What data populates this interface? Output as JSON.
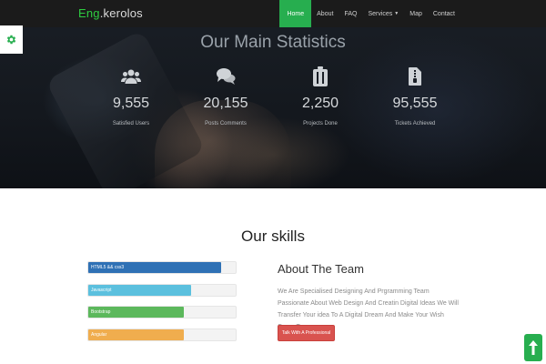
{
  "navbar": {
    "brand_prefix": "Eng",
    "brand_suffix": ".kerolos",
    "items": [
      {
        "label": "Home"
      },
      {
        "label": "About"
      },
      {
        "label": "FAQ"
      },
      {
        "label": "Services"
      },
      {
        "label": "Map"
      },
      {
        "label": "Contact"
      }
    ],
    "active_color": "#27ae4f"
  },
  "settings_icon": "gear-icon",
  "statistics": {
    "title": "Our Main Statistics",
    "items": [
      {
        "icon": "users-icon",
        "value": "9,555",
        "label": "Satisfied Users"
      },
      {
        "icon": "comments-icon",
        "value": "20,155",
        "label": "Posts Comments"
      },
      {
        "icon": "briefcase-icon",
        "value": "2,250",
        "label": "Projects Done"
      },
      {
        "icon": "file-icon",
        "value": "95,555",
        "label": "Tickets Achieved"
      }
    ]
  },
  "skills": {
    "title": "Our skills",
    "bars": [
      {
        "label": "HTML5 && css3",
        "percent": 90,
        "color": "#2f71b5"
      },
      {
        "label": "Javascript",
        "percent": 70,
        "color": "#5bc0de"
      },
      {
        "label": "Bootstrap",
        "percent": 65,
        "color": "#5cb85c"
      },
      {
        "label": "Angular",
        "percent": 65,
        "color": "#f0ad4e"
      }
    ]
  },
  "about": {
    "title": "About The Team",
    "text": "We Are Specialised Designing And Prgramming Team Passionate About Web Design And Creatin Digital Ideas We Will Transfer Your idea To A Digital Dream And Make Your Wish Come True",
    "button_label": "Talk With A Professional",
    "button_color": "#d9534f"
  },
  "scroll_top_icon": "arrow-up-icon"
}
